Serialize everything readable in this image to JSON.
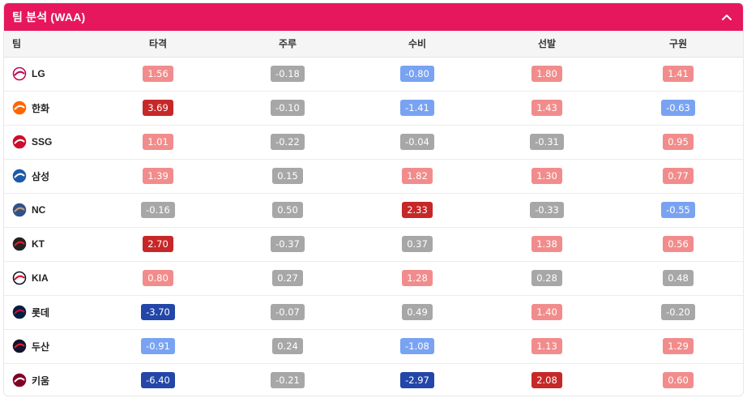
{
  "header": {
    "title": "팀 분석 (WAA)"
  },
  "icons": {
    "collapse": "chevron-up-icon"
  },
  "table": {
    "columns": [
      "팀",
      "타격",
      "주루",
      "수비",
      "선발",
      "구원"
    ],
    "rows": [
      {
        "team": "LG",
        "logo": {
          "bg": "#ffffff",
          "fg": "#c30452",
          "ring": "#c30452"
        },
        "cells": [
          {
            "v": "1.56",
            "c": "rs"
          },
          {
            "v": "-0.18",
            "c": "gy"
          },
          {
            "v": "-0.80",
            "c": "bl"
          },
          {
            "v": "1.80",
            "c": "rs"
          },
          {
            "v": "1.41",
            "c": "rs"
          }
        ]
      },
      {
        "team": "한화",
        "logo": {
          "bg": "#ff6600",
          "fg": "#ffffff",
          "ring": "#ff6600"
        },
        "cells": [
          {
            "v": "3.69",
            "c": "rd"
          },
          {
            "v": "-0.10",
            "c": "gy"
          },
          {
            "v": "-1.41",
            "c": "bl"
          },
          {
            "v": "1.43",
            "c": "rs"
          },
          {
            "v": "-0.63",
            "c": "bl"
          }
        ]
      },
      {
        "team": "SSG",
        "logo": {
          "bg": "#ce0e2d",
          "fg": "#ffffff",
          "ring": "#ce0e2d"
        },
        "cells": [
          {
            "v": "1.01",
            "c": "rs"
          },
          {
            "v": "-0.22",
            "c": "gy"
          },
          {
            "v": "-0.04",
            "c": "gy"
          },
          {
            "v": "-0.31",
            "c": "gy"
          },
          {
            "v": "0.95",
            "c": "rs"
          }
        ]
      },
      {
        "team": "삼성",
        "logo": {
          "bg": "#1f5aa8",
          "fg": "#ffffff",
          "ring": "#1f5aa8"
        },
        "cells": [
          {
            "v": "1.39",
            "c": "rs"
          },
          {
            "v": "0.15",
            "c": "gy"
          },
          {
            "v": "1.82",
            "c": "rs"
          },
          {
            "v": "1.30",
            "c": "rs"
          },
          {
            "v": "0.77",
            "c": "rs"
          }
        ]
      },
      {
        "team": "NC",
        "logo": {
          "bg": "#315288",
          "fg": "#c7a079",
          "ring": "#315288"
        },
        "cells": [
          {
            "v": "-0.16",
            "c": "gy"
          },
          {
            "v": "0.50",
            "c": "gy"
          },
          {
            "v": "2.33",
            "c": "rd"
          },
          {
            "v": "-0.33",
            "c": "gy"
          },
          {
            "v": "-0.55",
            "c": "bl"
          }
        ]
      },
      {
        "team": "KT",
        "logo": {
          "bg": "#222222",
          "fg": "#ed1c24",
          "ring": "#222222"
        },
        "cells": [
          {
            "v": "2.70",
            "c": "rd"
          },
          {
            "v": "-0.37",
            "c": "gy"
          },
          {
            "v": "0.37",
            "c": "gy"
          },
          {
            "v": "1.38",
            "c": "rs"
          },
          {
            "v": "0.56",
            "c": "rs"
          }
        ]
      },
      {
        "team": "KIA",
        "logo": {
          "bg": "#ffffff",
          "fg": "#ea0029",
          "ring": "#06141f"
        },
        "cells": [
          {
            "v": "0.80",
            "c": "rs"
          },
          {
            "v": "0.27",
            "c": "gy"
          },
          {
            "v": "1.28",
            "c": "rs"
          },
          {
            "v": "0.28",
            "c": "gy"
          },
          {
            "v": "0.48",
            "c": "gy"
          }
        ]
      },
      {
        "team": "롯데",
        "logo": {
          "bg": "#041e42",
          "fg": "#d00f31",
          "ring": "#041e42"
        },
        "cells": [
          {
            "v": "-3.70",
            "c": "bd"
          },
          {
            "v": "-0.07",
            "c": "gy"
          },
          {
            "v": "0.49",
            "c": "gy"
          },
          {
            "v": "1.40",
            "c": "rs"
          },
          {
            "v": "-0.20",
            "c": "gy"
          }
        ]
      },
      {
        "team": "두산",
        "logo": {
          "bg": "#131230",
          "fg": "#ed1c24",
          "ring": "#131230"
        },
        "cells": [
          {
            "v": "-0.91",
            "c": "bl"
          },
          {
            "v": "0.24",
            "c": "gy"
          },
          {
            "v": "-1.08",
            "c": "bl"
          },
          {
            "v": "1.13",
            "c": "rs"
          },
          {
            "v": "1.29",
            "c": "rs"
          }
        ]
      },
      {
        "team": "키움",
        "logo": {
          "bg": "#820024",
          "fg": "#ffffff",
          "ring": "#820024"
        },
        "cells": [
          {
            "v": "-6.40",
            "c": "bd"
          },
          {
            "v": "-0.21",
            "c": "gy"
          },
          {
            "v": "-2.97",
            "c": "bd"
          },
          {
            "v": "2.08",
            "c": "rd"
          },
          {
            "v": "0.60",
            "c": "rs"
          }
        ]
      }
    ]
  }
}
